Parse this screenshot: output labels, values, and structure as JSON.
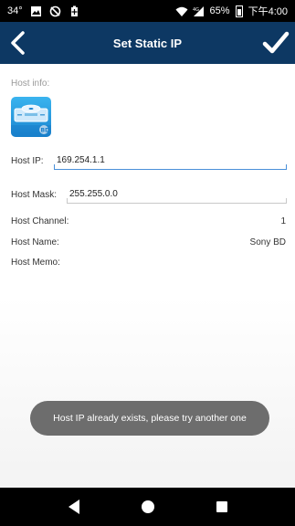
{
  "status_bar": {
    "temperature": "34°",
    "battery_percent": "65%",
    "time": "下午4:00",
    "icons": [
      "image-icon",
      "no-sync-icon",
      "battery-saver-icon",
      "wifi-icon",
      "signal-icon",
      "battery-icon"
    ]
  },
  "title_bar": {
    "title": "Set Static IP",
    "back_icon": "chevron-left-icon",
    "confirm_icon": "checkmark-icon",
    "background_color": "#0d3863"
  },
  "host": {
    "section_label": "Host info:",
    "icon": "bluray-player-icon",
    "ip_label": "Host IP:",
    "ip_value": "169.254.1.1",
    "mask_label": "Host Mask:",
    "mask_value": "255.255.0.0",
    "channel_label": "Host Channel:",
    "channel_value": "1",
    "name_label": "Host Name:",
    "name_value": "Sony BD",
    "memo_label": "Host Memo:",
    "memo_value": ""
  },
  "toast": {
    "message": "Host IP already exists, please try another one"
  },
  "nav_bar": {
    "icons": [
      "back-triangle-icon",
      "home-circle-icon",
      "recents-square-icon"
    ]
  }
}
